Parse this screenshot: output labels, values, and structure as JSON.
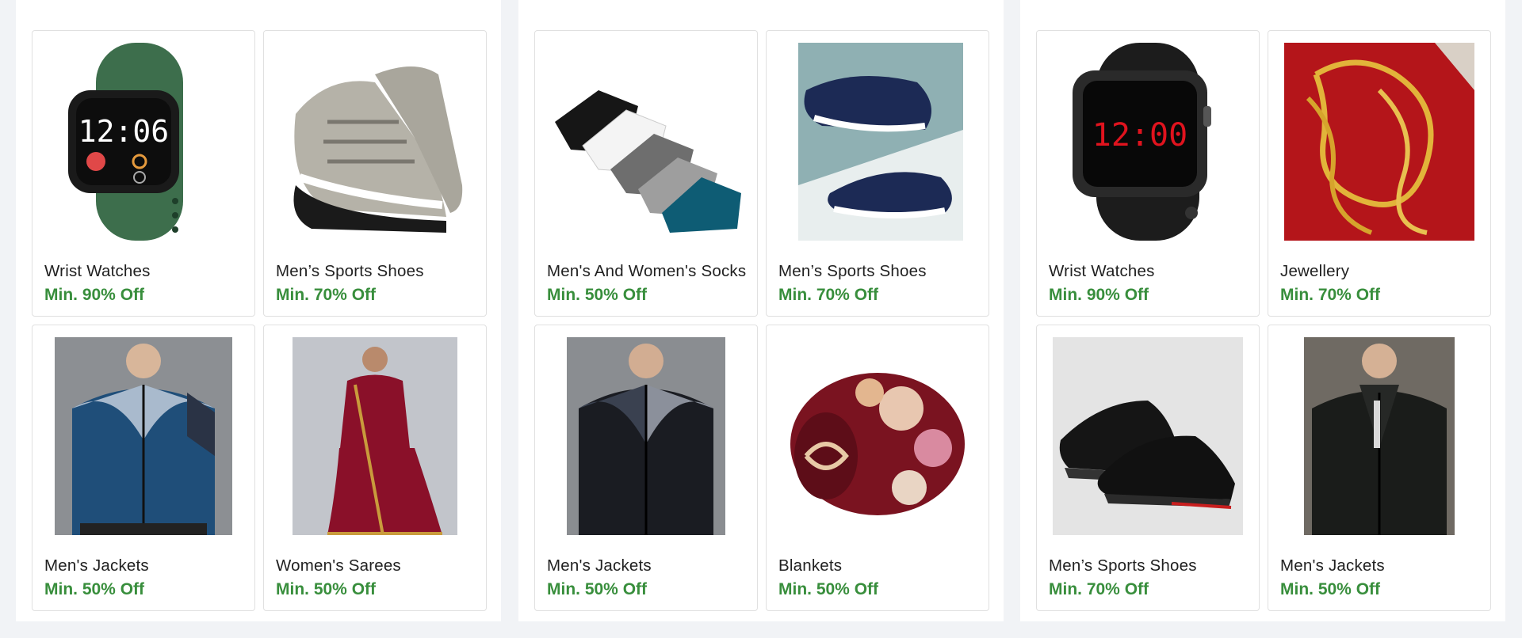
{
  "colors": {
    "offer": "#388e3c",
    "label": "#212121",
    "page_bg": "#f1f3f6",
    "card_border": "#e0e0e0"
  },
  "groups": [
    {
      "cards": [
        {
          "label": "Wrist Watches",
          "offer": "Min. 90% Off",
          "image": "green-smartwatch-image"
        },
        {
          "label": "Men’s Sports Shoes",
          "offer": "Min. 70% Off",
          "image": "grey-sports-shoes-image"
        },
        {
          "label": "Men's Jackets",
          "offer": "Min. 50% Off",
          "image": "blue-jacket-image"
        },
        {
          "label": "Women's Sarees",
          "offer": "Min. 50% Off",
          "image": "red-saree-image"
        }
      ]
    },
    {
      "cards": [
        {
          "label": "Men's And Women's Socks",
          "offer": "Min. 50% Off",
          "image": "ankle-socks-image"
        },
        {
          "label": "Men’s Sports Shoes",
          "offer": "Min. 70% Off",
          "image": "navy-sports-shoes-image"
        },
        {
          "label": "Men's Jackets",
          "offer": "Min. 50% Off",
          "image": "black-grey-jacket-image"
        },
        {
          "label": "Blankets",
          "offer": "Min. 50% Off",
          "image": "floral-blanket-image"
        }
      ]
    },
    {
      "cards": [
        {
          "label": "Wrist Watches",
          "offer": "Min. 90% Off",
          "image": "black-led-watch-image"
        },
        {
          "label": "Jewellery",
          "offer": "Min. 70% Off",
          "image": "gold-chain-image"
        },
        {
          "label": "Men’s Sports Shoes",
          "offer": "Min. 70% Off",
          "image": "black-sneakers-image"
        },
        {
          "label": "Men's Jackets",
          "offer": "Min. 50% Off",
          "image": "black-jacket-image"
        }
      ]
    }
  ]
}
